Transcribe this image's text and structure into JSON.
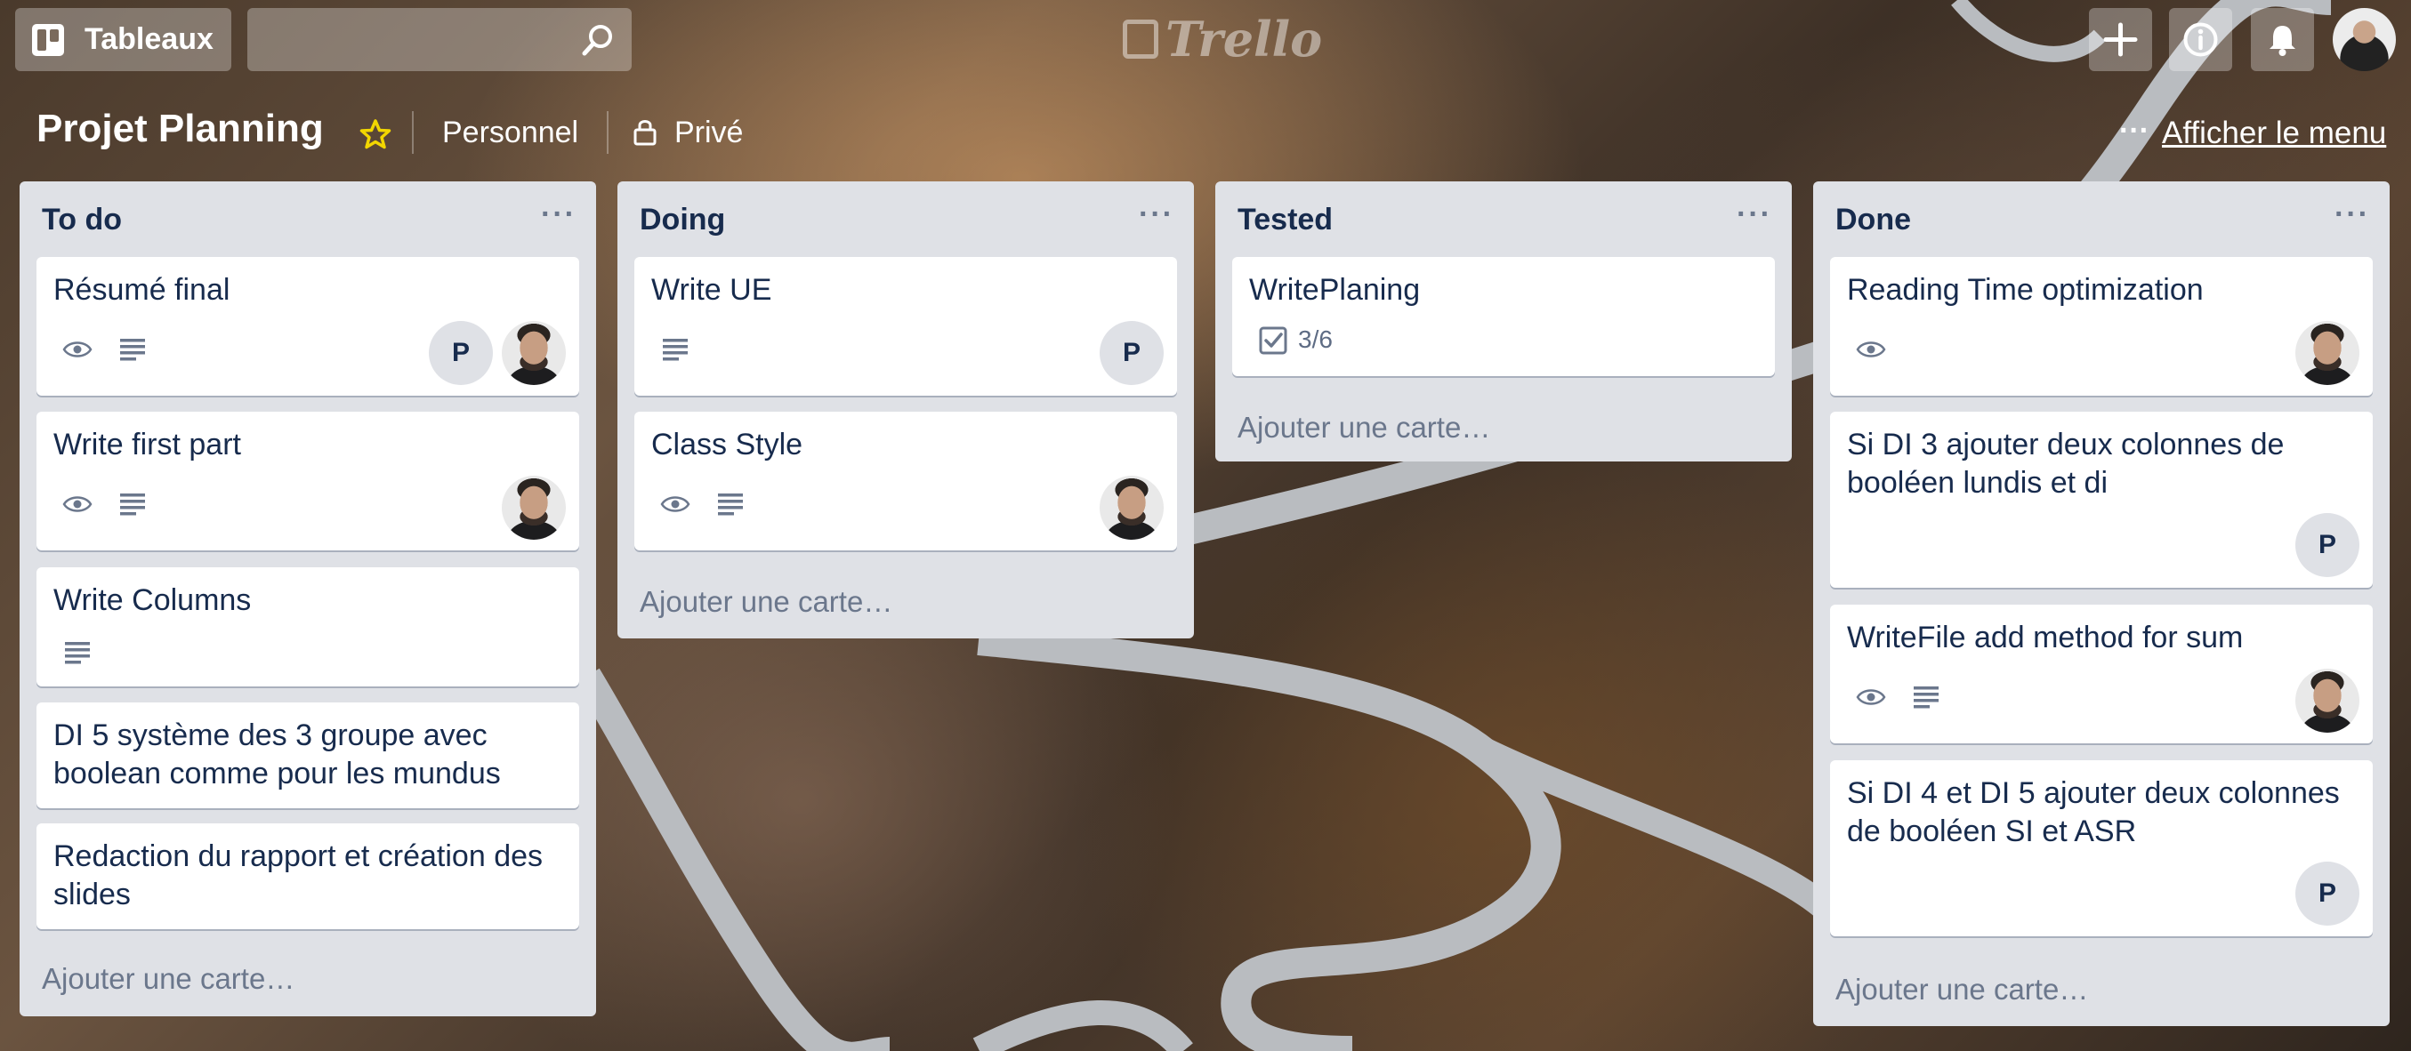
{
  "header": {
    "boards_label": "Tableaux",
    "search_placeholder": "",
    "logo_text": "Trello"
  },
  "board": {
    "title": "Projet Planning",
    "team": "Personnel",
    "visibility": "Privé",
    "menu_dots": "···",
    "show_menu": "Afficher le menu",
    "star_color": "#f2d600"
  },
  "lists": [
    {
      "title": "To do",
      "menu": "···",
      "add_card": "Ajouter une carte…",
      "cards": [
        {
          "title": "Résumé final",
          "members": [
            "P",
            "photo"
          ],
          "badges": [
            "eye-icon",
            "description-icon"
          ]
        },
        {
          "title": "Write first part",
          "members": [
            "photo"
          ],
          "badges": [
            "eye-icon",
            "description-icon"
          ]
        },
        {
          "title": "Write Columns",
          "members": [],
          "badges": [
            "description-icon"
          ]
        },
        {
          "title": "DI 5 système des 3 groupe avec boolean comme pour les mundus",
          "members": [],
          "badges": []
        },
        {
          "title": "Redaction du rapport et création des slides",
          "members": [],
          "badges": []
        }
      ]
    },
    {
      "title": "Doing",
      "menu": "···",
      "add_card": "Ajouter une carte…",
      "cards": [
        {
          "title": "Write UE",
          "members": [
            "P"
          ],
          "badges": [
            "description-icon"
          ]
        },
        {
          "title": "Class Style",
          "members": [
            "photo"
          ],
          "badges": [
            "eye-icon",
            "description-icon"
          ]
        }
      ]
    },
    {
      "title": "Tested",
      "menu": "···",
      "add_card": "Ajouter une carte…",
      "cards": [
        {
          "title": "WritePlaning",
          "members": [],
          "badges": [
            "checklist-icon"
          ],
          "checklist": "3/6"
        }
      ]
    },
    {
      "title": "Done",
      "menu": "···",
      "add_card": "Ajouter une carte…",
      "cards": [
        {
          "title": "Reading Time optimization",
          "members": [
            "photo"
          ],
          "badges": [
            "eye-icon"
          ]
        },
        {
          "title": "Si DI 3 ajouter deux colonnes de booléen lundis et di",
          "members": [
            "P"
          ],
          "badges": []
        },
        {
          "title": "WriteFile add method for sum",
          "members": [
            "photo"
          ],
          "badges": [
            "eye-icon",
            "description-icon"
          ]
        },
        {
          "title": "Si DI 4 et DI 5 ajouter deux colonnes de booléen SI et ASR",
          "members": [
            "P"
          ],
          "badges": []
        }
      ]
    }
  ]
}
